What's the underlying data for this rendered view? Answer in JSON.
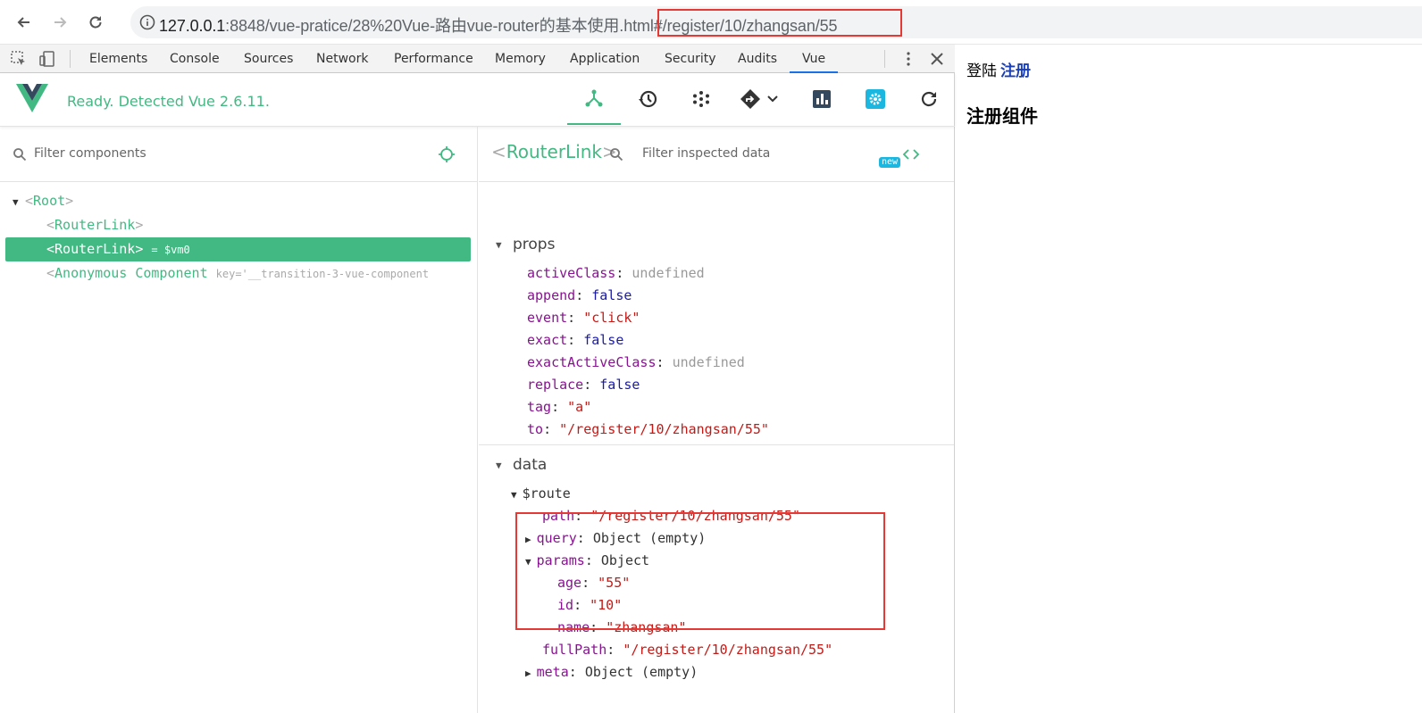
{
  "browser": {
    "url_host": "127.0.0.1",
    "url_rest": ":8848/vue-pratice/28%20Vue-路由vue-router的基本使用.html#/register/10/zhangsan/55"
  },
  "devtools": {
    "tabs": [
      "Elements",
      "Console",
      "Sources",
      "Network",
      "Performance",
      "Memory",
      "Application",
      "Security",
      "Audits",
      "Vue"
    ],
    "active_tab": "Vue"
  },
  "vue": {
    "status": "Ready. Detected Vue 2.6.11.",
    "new_badge": "new",
    "filter_components_placeholder": "Filter components",
    "filter_inspected_placeholder": "Filter inspected data",
    "tree": {
      "root": "Root",
      "child1": "RouterLink",
      "child2": "RouterLink",
      "child2_vm": "= $vm0",
      "child3": "Anonymous Component",
      "child3_key": "key='__transition-3-vue-component"
    },
    "inspected": {
      "name": "RouterLink",
      "props_title": "props",
      "props": {
        "activeClass_key": "activeClass",
        "activeClass_val": "undefined",
        "append_key": "append",
        "append_val": "false",
        "event_key": "event",
        "event_val": "\"click\"",
        "exact_key": "exact",
        "exact_val": "false",
        "exactActiveClass_key": "exactActiveClass",
        "exactActiveClass_val": "undefined",
        "replace_key": "replace",
        "replace_val": "false",
        "tag_key": "tag",
        "tag_val": "\"a\"",
        "to_key": "to",
        "to_val": "\"/register/10/zhangsan/55\""
      },
      "data_title": "data",
      "route": {
        "key": "$route",
        "path_key": "path",
        "path_val": "\"/register/10/zhangsan/55\"",
        "query_key": "query",
        "query_val": "Object (empty)",
        "params_key": "params",
        "params_val": "Object",
        "age_key": "age",
        "age_val": "\"55\"",
        "id_key": "id",
        "id_val": "\"10\"",
        "name_key": "name",
        "name_val": "\"zhangsan\"",
        "fullPath_key": "fullPath",
        "fullPath_val": "\"/register/10/zhangsan/55\"",
        "meta_key": "meta",
        "meta_val": "Object (empty)"
      }
    }
  },
  "page": {
    "link_login": "登陆",
    "link_register": "注册",
    "heading": "注册组件"
  },
  "colors": {
    "vue_green": "#42b983",
    "highlight_red": "#e53935",
    "link_blue": "#1a3fb5"
  }
}
